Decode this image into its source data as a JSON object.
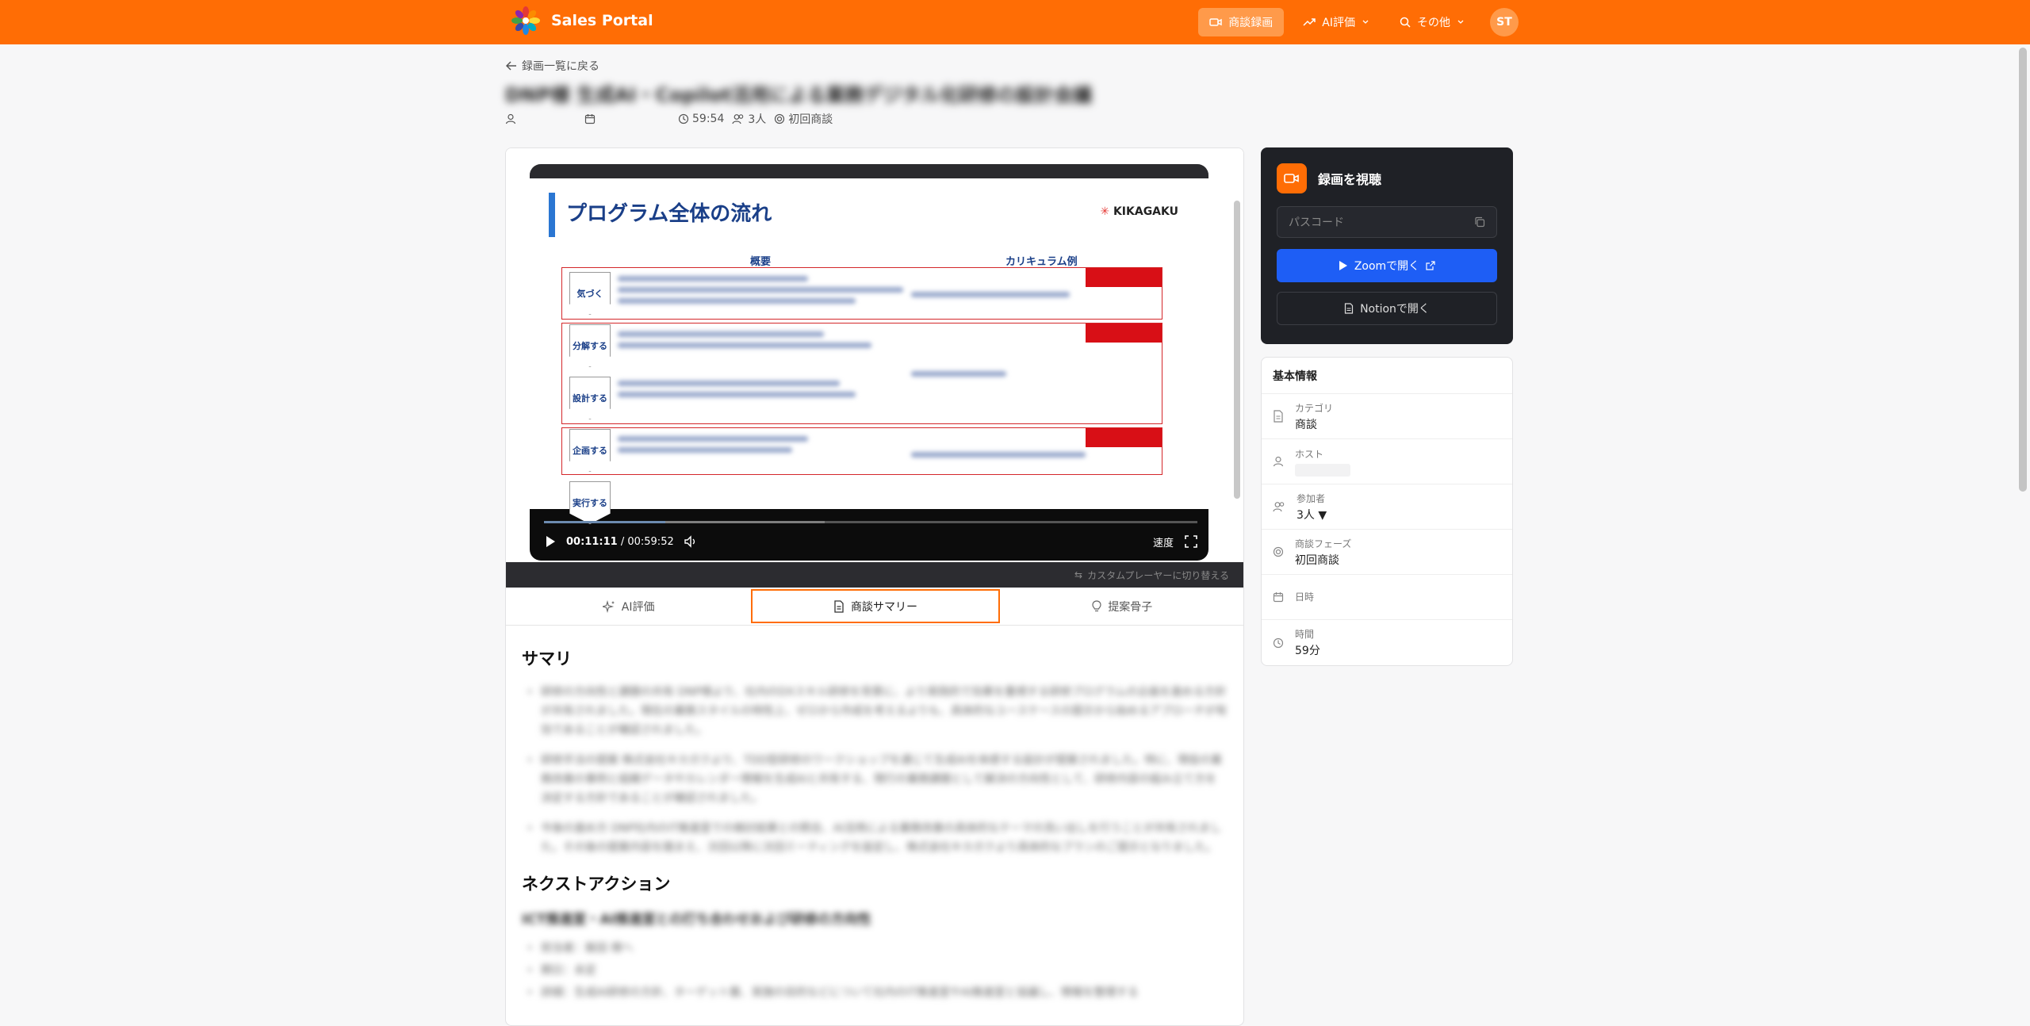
{
  "app": {
    "title": "Sales Portal"
  },
  "nav": {
    "recordings": "商談録画",
    "ai_eval": "AI評価",
    "more": "その他",
    "avatar": "ST"
  },
  "page": {
    "back": "録画一覧に戻る",
    "title": "DNP様 生成AI・Copilot活用による業務デジタル化研修の設計会議",
    "duration": "59:54",
    "participants": "3人",
    "phase": "初回商談"
  },
  "slide": {
    "title": "プログラム全体の流れ",
    "logo": "KIKAGAKU",
    "col1": "概要",
    "col2": "カリキュラム例",
    "steps": [
      "気づく",
      "分解する",
      "設計する",
      "企画する",
      "実行する"
    ]
  },
  "player": {
    "current": "00:11:11",
    "separator": "/",
    "total": "00:59:52",
    "progress_fraction": 0.186,
    "speed": "速度",
    "switch": "カスタムプレーヤーに切り替える"
  },
  "tabs": [
    "AI評価",
    "商談サマリー",
    "提案骨子"
  ],
  "summary": {
    "heading": "サマリ",
    "bullets": [
      "研修の方向性と課題の共有 DNP様より、社内のDXスキル研修を背景に、より実践的で効果を重視する研修プログラムの企画を進める方針が共有されました。現在の業務スタイルの特性上、ゼロから作成を考えるよりも、具体的なユースケースの提示から始めるアプローチが有効であることが確認されました。",
      "研修手法の提案 株式会社キカガクより、TDD型研修のワークショップを通じて生成AIを体感する設計が提案されました。特に、現役の業務改善の事例と組織データやカレンダー情報を生成AIと共有する、現行の業務課題として解決の方向性として、研修内容の組み立て方を決定する方針であることが確認されました。",
      "今後の進め方 DNP社内のIT推進室での検討結果との照合、AI活用による業務改善の具体的なテーマの洗い出しを行うことが共有されました。その後の提案内容を踏まえ、次回以降に次回ミーティングを設定し、株式会社キカガクより具体的なプランのご提示となりました。"
    ],
    "next_heading": "ネクストアクション",
    "next_sub": "ICT推進室・AI推進室との打ち合わせおよび研修の方向性",
    "next_items": [
      "担当者：飯田 様へ",
      "期日：未定",
      "詳細：生成AI研修の方針、ターゲット層、実施の目的などについて社内のIT推進室やAI推進室と協議し、情報を整理する"
    ]
  },
  "side": {
    "watch_title": "録画を視聴",
    "passcode_placeholder": "パスコード",
    "zoom_btn": "Zoomで開く",
    "notion_btn": "Notionで開く",
    "info_title": "基本情報",
    "rows": [
      {
        "label": "カテゴリ",
        "value": "商談"
      },
      {
        "label": "ホスト",
        "value": ""
      },
      {
        "label": "参加者",
        "value": "3人 ▼"
      },
      {
        "label": "商談フェーズ",
        "value": "初回商談"
      },
      {
        "label": "日時",
        "value": ""
      },
      {
        "label": "時間",
        "value": "59分"
      }
    ]
  },
  "colors": {
    "accent": "#ff6d05",
    "zoom": "#1e5ef5",
    "dark_panel": "#1f2126"
  }
}
